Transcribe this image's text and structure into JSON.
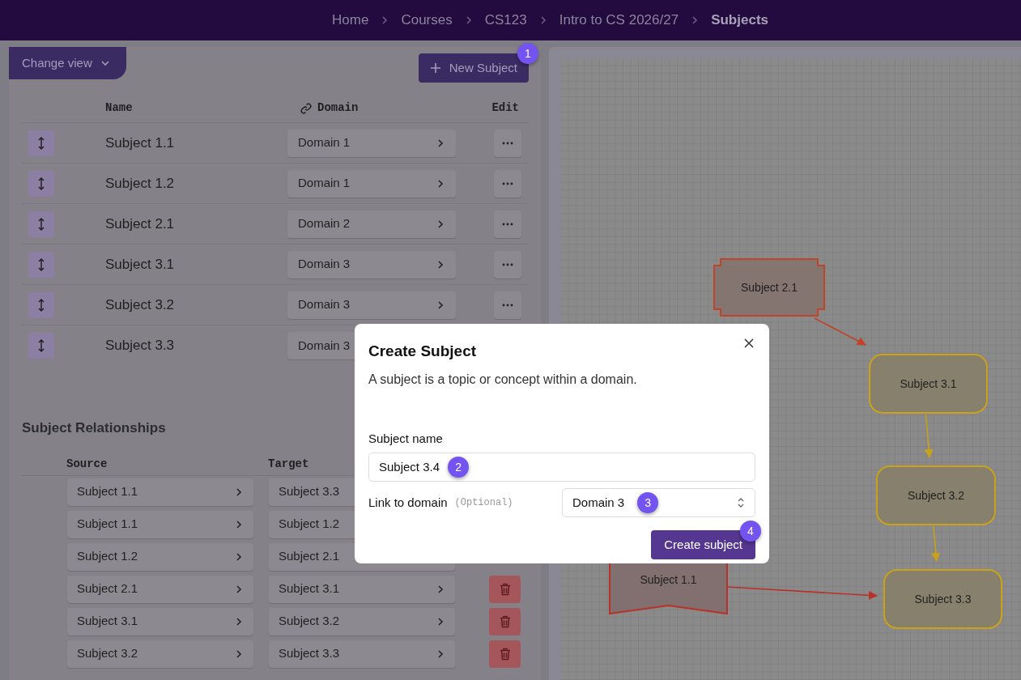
{
  "breadcrumbs": [
    {
      "label": "Home",
      "current": false
    },
    {
      "label": "Courses",
      "current": false
    },
    {
      "label": "CS123",
      "current": false
    },
    {
      "label": "Intro to CS 2026/27",
      "current": false
    },
    {
      "label": "Subjects",
      "current": true
    }
  ],
  "change_view": "Change view",
  "new_subject": {
    "label": "New Subject",
    "badge": "1"
  },
  "subjects_table": {
    "columns": [
      "Name",
      "Domain",
      "Edit"
    ],
    "rows": [
      {
        "name": "Subject 1.1",
        "domain": "Domain 1"
      },
      {
        "name": "Subject 1.2",
        "domain": "Domain 1"
      },
      {
        "name": "Subject 2.1",
        "domain": "Domain 2"
      },
      {
        "name": "Subject 3.1",
        "domain": "Domain 3"
      },
      {
        "name": "Subject 3.2",
        "domain": "Domain 3"
      },
      {
        "name": "Subject 3.3",
        "domain": "Domain 3"
      }
    ]
  },
  "relationships": {
    "title": "Subject Relationships",
    "columns": [
      "Source",
      "Target"
    ],
    "rows": [
      {
        "source": "Subject 1.1",
        "target": "Subject 3.3"
      },
      {
        "source": "Subject 1.1",
        "target": "Subject 1.2"
      },
      {
        "source": "Subject 1.2",
        "target": "Subject 2.1"
      },
      {
        "source": "Subject 2.1",
        "target": "Subject 3.1"
      },
      {
        "source": "Subject 3.1",
        "target": "Subject 3.2"
      },
      {
        "source": "Subject 3.2",
        "target": "Subject 3.3"
      }
    ]
  },
  "graph": {
    "nodes": [
      {
        "label": "Subject 2.1",
        "kind": "notched",
        "color": "#c0442a"
      },
      {
        "label": "Subject 3.1",
        "kind": "rounded",
        "color": "#c9a21a"
      },
      {
        "label": "Subject 3.2",
        "kind": "rounded",
        "color": "#c9a21a"
      },
      {
        "label": "Subject 3.3",
        "kind": "rounded",
        "color": "#c9a21a"
      },
      {
        "label": "Subject 1.1",
        "kind": "banner",
        "color": "#b8322a"
      }
    ],
    "edges": [
      {
        "color": "#c0442a"
      },
      {
        "color": "#c9a21a"
      },
      {
        "color": "#c9a21a"
      },
      {
        "color": "#b8322a"
      }
    ]
  },
  "dialog": {
    "title": "Create Subject",
    "description": "A subject is a topic or concept within a domain.",
    "name_label": "Subject name",
    "name_value": "Subject 3.4",
    "name_badge": "2",
    "domain_label": "Link to domain",
    "domain_optional": "(Optional)",
    "domain_value": "Domain 3",
    "domain_badge": "3",
    "submit": "Create subject",
    "submit_badge": "4"
  }
}
